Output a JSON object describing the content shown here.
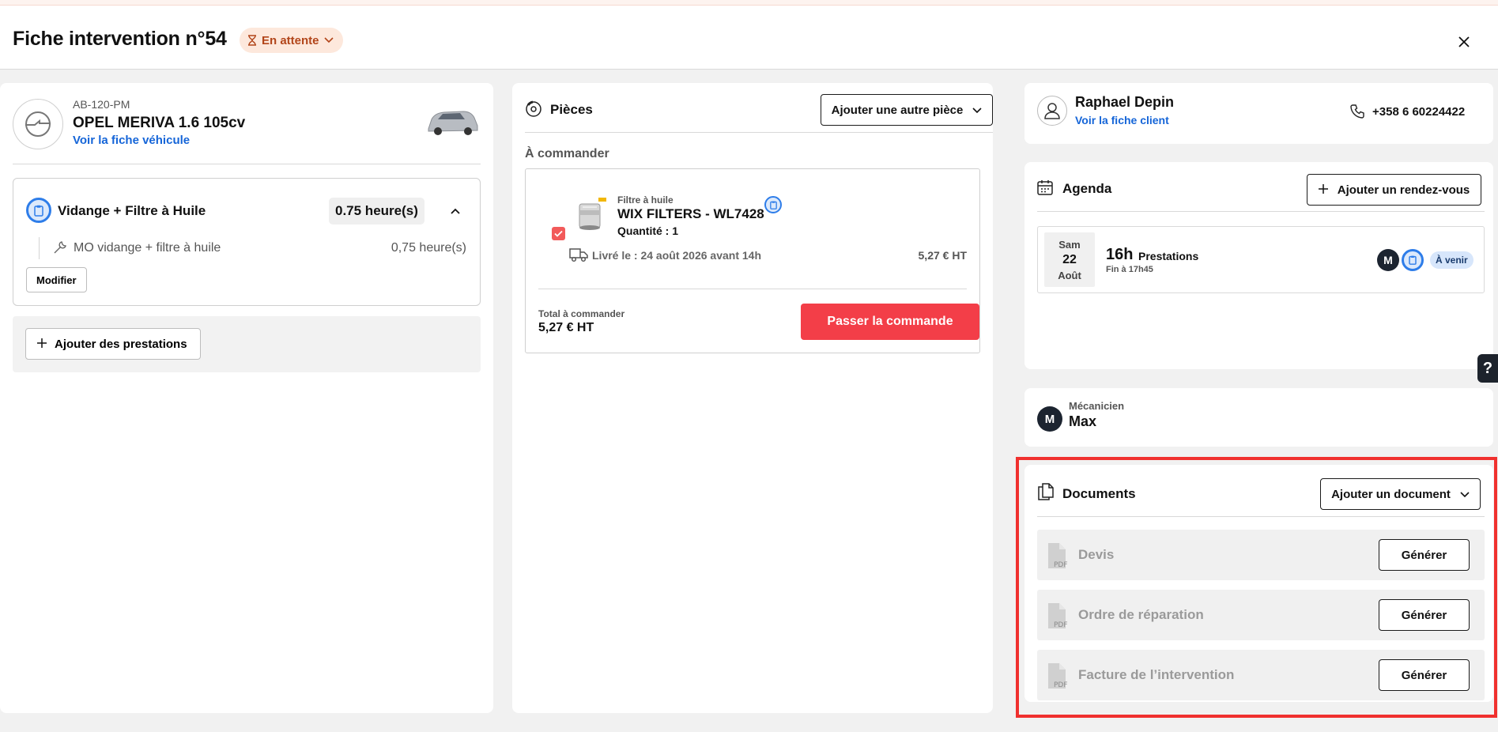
{
  "header": {
    "title": "Fiche intervention n°54",
    "status": "En attente"
  },
  "vehicle": {
    "plate": "AB-120-PM",
    "name": "OPEL MERIVA 1.6 105cv",
    "link": "Voir la fiche véhicule"
  },
  "service": {
    "title": "Vidange + Filtre à Huile",
    "hours": "0.75 heure(s)",
    "item_label": "MO vidange + filtre à huile",
    "item_hours": "0,75 heure(s)",
    "edit_label": "Modifier",
    "add_label": "Ajouter des prestations"
  },
  "parts": {
    "title": "Pièces",
    "add_label": "Ajouter une autre pièce",
    "subhead": "À commander",
    "item": {
      "category": "Filtre à huile",
      "name": "WIX FILTERS - WL7428",
      "quantity": "Quantité : 1",
      "delivery": "Livré le : 24 août 2026 avant 14h",
      "price": "5,27 € HT",
      "checked": true
    },
    "total_label": "Total à commander",
    "total_value": "5,27 € HT",
    "order_button": "Passer la commande"
  },
  "client": {
    "name": "Raphael Depin",
    "link": "Voir la fiche client",
    "phone": "+358 6 60224422"
  },
  "agenda": {
    "title": "Agenda",
    "add_label": "Ajouter un rendez-vous",
    "appointment": {
      "day": "Sam",
      "date": "22",
      "month": "Août",
      "time": "16h",
      "kind": "Prestations",
      "end": "Fin à 17h45",
      "avatar": "M",
      "status": "À venir"
    }
  },
  "mechanic": {
    "avatar": "M",
    "label": "Mécanicien",
    "name": "Max"
  },
  "documents": {
    "title": "Documents",
    "add_label": "Ajouter un document",
    "generate_label": "Générer",
    "items": [
      {
        "label": "Devis"
      },
      {
        "label": "Ordre de réparation"
      },
      {
        "label": "Facture de l’intervention"
      }
    ]
  },
  "colors": {
    "accent_red": "#f33e48",
    "link_blue": "#1565d8",
    "status_bg": "#fde8dc",
    "status_text": "#b2451a",
    "highlight": "#f0302e"
  },
  "help": "?"
}
